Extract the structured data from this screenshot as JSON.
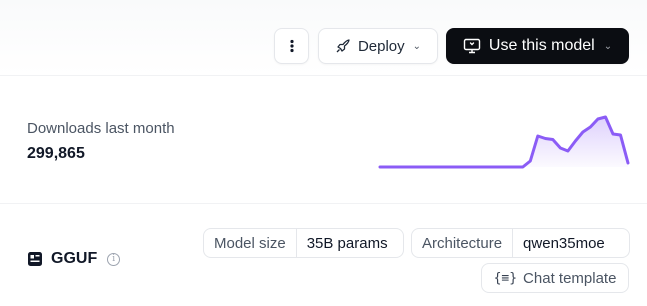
{
  "header": {
    "more_icon": "vertical-dots-icon",
    "deploy": {
      "label": "Deploy",
      "icon": "rocket-icon"
    },
    "use_model": {
      "label": "Use this model",
      "icon": "monitor-icon"
    }
  },
  "downloads": {
    "label": "Downloads last month",
    "value": "299,865",
    "trend": [
      0,
      0,
      0,
      0,
      0,
      0,
      0,
      0,
      0,
      0,
      0,
      0,
      0,
      0,
      0,
      0,
      0,
      0,
      0,
      0,
      0.12,
      0.62,
      0.57,
      0.55,
      0.38,
      0.32,
      0.52,
      0.7,
      0.8,
      0.96,
      1.0,
      0.66,
      0.64,
      0.08
    ],
    "color": "#8b5cf6"
  },
  "gguf": {
    "label": "GGUF",
    "icon": "gguf-icon",
    "info_icon": "info-icon",
    "model_size": {
      "key": "Model size",
      "value": "35B params"
    },
    "architecture": {
      "key": "Architecture",
      "value": "qwen35moe"
    },
    "chat_template": {
      "label": "Chat template",
      "icon": "code-braces-icon"
    }
  }
}
